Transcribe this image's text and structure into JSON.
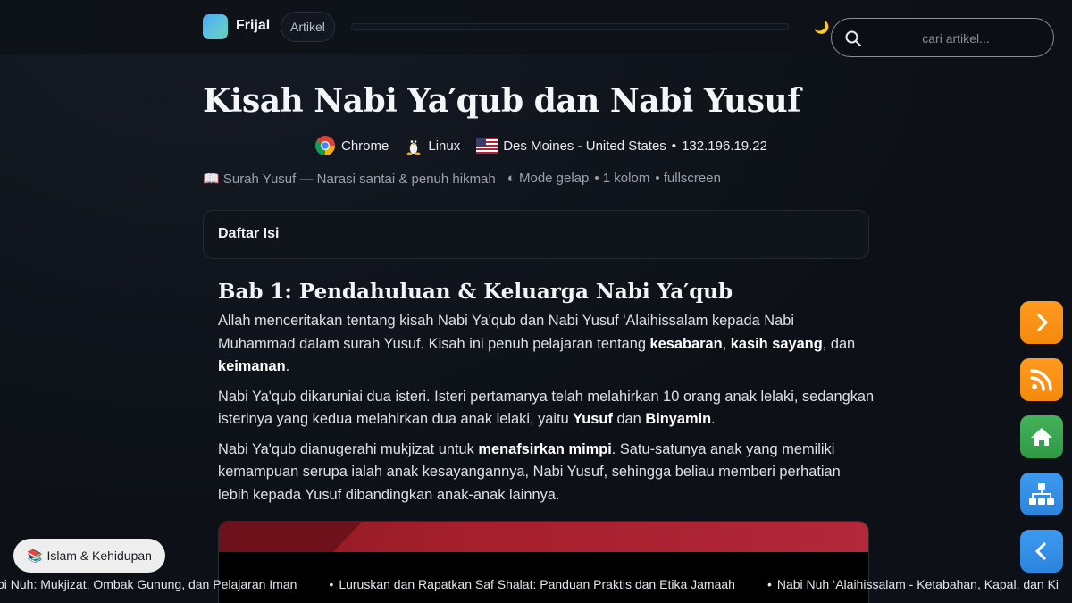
{
  "header": {
    "brand": "Frijal",
    "nav_label": "Artikel",
    "reading_progress": 0,
    "theme_toggle_icon": "moon-icon",
    "search_placeholder": "cari artikel..."
  },
  "article": {
    "title": "Kisah Nabi Ya′qub dan Nabi Yusuf",
    "visitor": {
      "browser": "Chrome",
      "os": "Linux",
      "location": "Des Moines - United States",
      "separator": "•",
      "ip": "132.196.19.22"
    },
    "meta": {
      "surah": "📖 Surah Yusuf — Narasi santai & penuh hikmah",
      "mode": "◐ Mode gelap",
      "layout": "• 1 kolom",
      "view": "• fullscreen"
    },
    "toc_title": "Daftar Isi",
    "chapter": {
      "heading": "Bab 1: Pendahuluan & Keluarga Nabi Ya′qub",
      "p1_a": "Allah menceritakan tentang kisah Nabi Ya'qub dan Nabi Yusuf 'Alaihissalam kepada Nabi Muhammad dalam surah Yusuf. Kisah ini penuh pelajaran tentang ",
      "p1_b1": "kesabaran",
      "p1_c": ", ",
      "p1_b2": "kasih sayang",
      "p1_d": ", dan ",
      "p1_b3": "keimanan",
      "p1_e": ".",
      "p2_a": "Nabi Ya'qub dikaruniai dua isteri. Isteri pertamanya telah melahirkan 10 orang anak lelaki, sedangkan isterinya yang kedua melahirkan dua anak lelaki, yaitu ",
      "p2_b1": "Yusuf",
      "p2_c": " dan ",
      "p2_b2": "Binyamin",
      "p2_d": ".",
      "p3_a": "Nabi Ya'qub dianugerahi mukjizat untuk ",
      "p3_b1": "menafsirkan mimpi",
      "p3_c": ". Satu-satunya anak yang memiliki kemampuan serupa ialah anak kesayangannya, Nabi Yusuf, sehingga beliau memberi perhatian lebih kepada Yusuf dibandingkan anak-anak lainnya."
    }
  },
  "floating_buttons": [
    {
      "icon": "chevron-right-icon",
      "color": "#f7941d"
    },
    {
      "icon": "rss-icon",
      "color": "#f7941d"
    },
    {
      "icon": "home-icon",
      "color": "#3ea852"
    },
    {
      "icon": "sitemap-icon",
      "color": "#3590e6"
    },
    {
      "icon": "chevron-left-icon",
      "color": "#3590e6"
    }
  ],
  "category": {
    "icon": "📚",
    "label": "Islam & Kehidupan"
  },
  "ticker": [
    "bi Nuh: Mukjizat, Ombak Gunung, dan Pelajaran Iman",
    "Luruskan dan Rapatkan Saf Shalat: Panduan Praktis dan Etika Jamaah",
    "Nabi Nuh ‘Alaihissalam - Ketabahan, Kapal, dan Ki"
  ],
  "colors": {
    "background": "#0d1117",
    "accent_orange": "#f7941d",
    "accent_green": "#3ea852",
    "accent_blue": "#3590e6"
  }
}
